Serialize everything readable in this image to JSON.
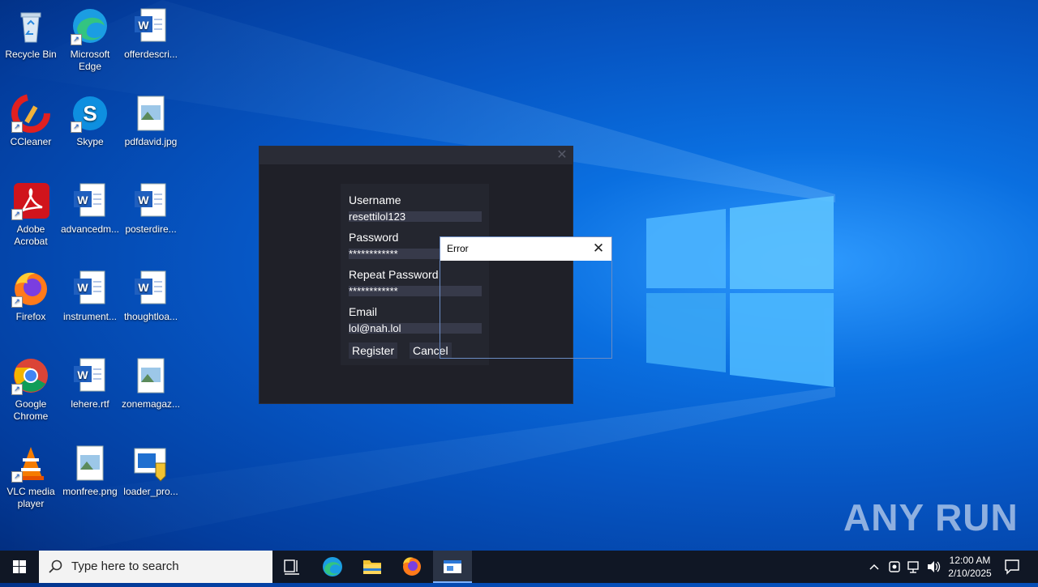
{
  "desktop": {
    "icons": [
      {
        "label": "Recycle Bin"
      },
      {
        "label": "Microsoft Edge"
      },
      {
        "label": "offerdescri..."
      },
      {
        "label": "CCleaner"
      },
      {
        "label": "Skype"
      },
      {
        "label": "pdfdavid.jpg"
      },
      {
        "label": "Adobe Acrobat"
      },
      {
        "label": "advancedm..."
      },
      {
        "label": "posterdire..."
      },
      {
        "label": "Firefox"
      },
      {
        "label": "instrument..."
      },
      {
        "label": "thoughtloa..."
      },
      {
        "label": "Google Chrome"
      },
      {
        "label": "lehere.rtf"
      },
      {
        "label": "zonemagaz..."
      },
      {
        "label": "VLC media player"
      },
      {
        "label": "monfree.png"
      },
      {
        "label": "loader_pro..."
      }
    ]
  },
  "register_form": {
    "username_label": "Username",
    "username_value": "resettilol123",
    "password_label": "Password",
    "password_value": "************",
    "repeat_password_label": "Repeat Password",
    "repeat_password_value": "************",
    "email_label": "Email",
    "email_value": "lol@nah.lol",
    "register_button": "Register",
    "cancel_button": "Cancel"
  },
  "error_dialog": {
    "title": "Error"
  },
  "taskbar": {
    "search_placeholder": "Type here to search",
    "time": "12:00 AM",
    "date": "2/10/2025"
  },
  "watermark": "ANY RUN",
  "colors": {
    "accent": "#0a6fe0",
    "app_bg": "#1f2028",
    "input_bg": "#373a4a"
  }
}
